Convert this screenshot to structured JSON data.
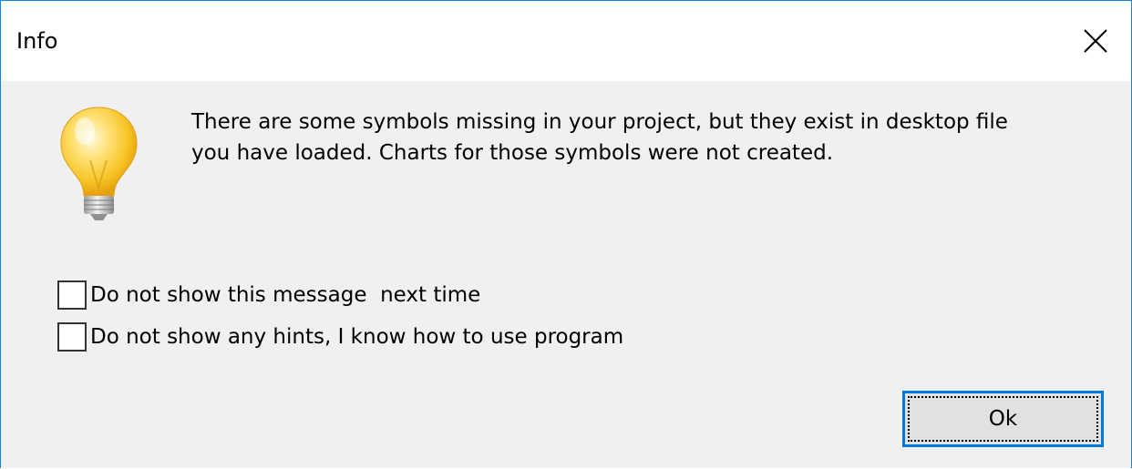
{
  "dialog": {
    "title": "Info",
    "icon": "lightbulb-icon",
    "message_lines": [
      "There are some symbols missing in your project, but they exist in desktop file",
      "you have loaded. Charts for those symbols were not created."
    ],
    "checkboxes": [
      {
        "label": "Do not show this message  next time",
        "checked": false
      },
      {
        "label": "Do not show any hints, I know how to use program",
        "checked": false
      }
    ],
    "ok_label": "Ok"
  },
  "colors": {
    "window_border": "#1883d7",
    "title_bg": "#ffffff",
    "body_bg": "#f0f0f0",
    "button_focus_border": "#0078d7",
    "button_bg": "#e1e1e1"
  }
}
